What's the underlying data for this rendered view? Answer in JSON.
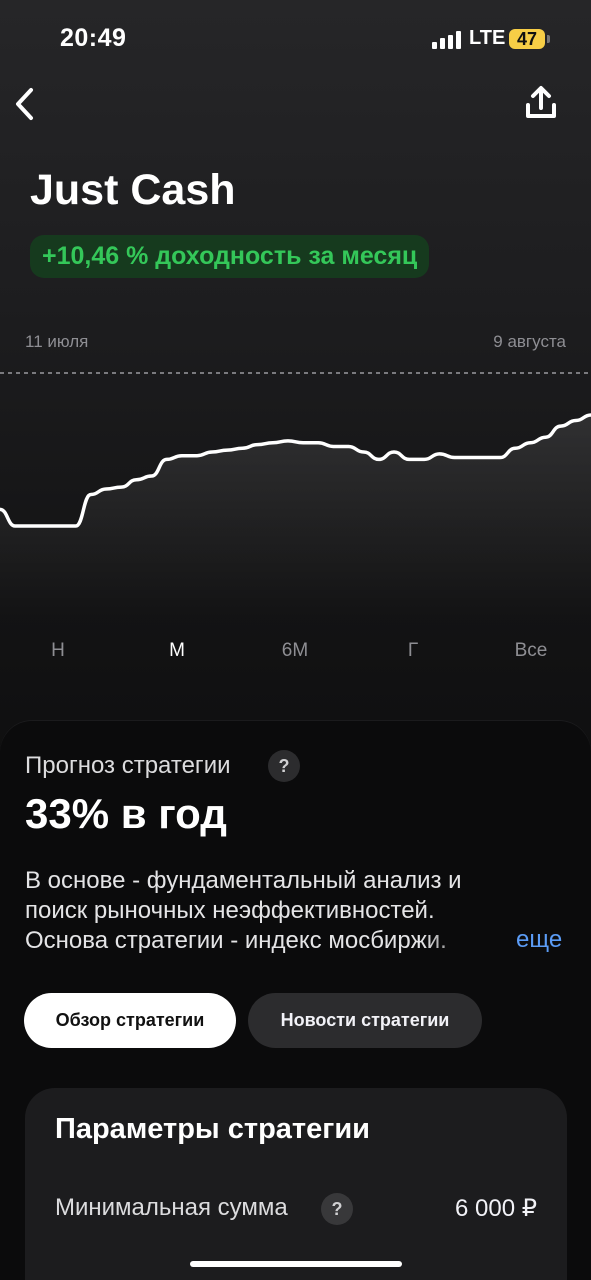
{
  "status_bar": {
    "time": "20:49",
    "network": "LTE",
    "battery": "47"
  },
  "header": {
    "back_icon": "chevron-left-icon",
    "share_icon": "share-icon"
  },
  "strategy": {
    "name": "Just Cash",
    "monthly_return": "+10,46 % доходность за месяц"
  },
  "chart_data": {
    "type": "area",
    "x_start_label": "11 июля",
    "x_end_label": "9 августа",
    "values": [
      49,
      40,
      40,
      40,
      40,
      40,
      57,
      60,
      61,
      65,
      67,
      76,
      78,
      78,
      80,
      81,
      82,
      84,
      85,
      86,
      85,
      85,
      83,
      83,
      80,
      76,
      80,
      76,
      76,
      79,
      77,
      77,
      77,
      77,
      82,
      85,
      88,
      94,
      97,
      100
    ],
    "ylim": [
      0,
      100
    ],
    "line_color": "#ffffff"
  },
  "periods": {
    "items": [
      {
        "label": "Н",
        "active": false
      },
      {
        "label": "М",
        "active": true
      },
      {
        "label": "6М",
        "active": false
      },
      {
        "label": "Г",
        "active": false
      },
      {
        "label": "Все",
        "active": false
      }
    ]
  },
  "forecast": {
    "label": "Прогноз стратегии",
    "help": "?",
    "value": "33% в год",
    "description_lines": [
      "В основе - фундаментальный анализ и",
      "поиск рыночных неэффективностей.",
      "Основа стратегии - индекс мосбиржи."
    ],
    "more_label": "еще"
  },
  "tabs": {
    "overview": "Обзор стратегии",
    "news": "Новости стратегии"
  },
  "parameters": {
    "title": "Параметры стратегии",
    "min_amount_label": "Минимальная сумма",
    "help": "?",
    "min_amount_value": "6 000 ₽"
  },
  "colors": {
    "positive": "#34c759",
    "positive_bg": "#163a1e",
    "link": "#5b9cf6",
    "battery": "#f7ce46"
  }
}
